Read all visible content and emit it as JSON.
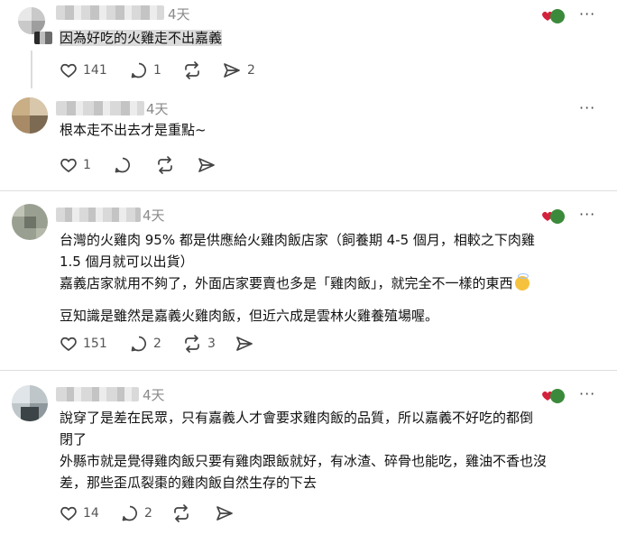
{
  "posts": [
    {
      "time": "4天",
      "lines": [
        "因為好吃的火雞走不出嘉義"
      ],
      "likes": "141",
      "replies": "1",
      "reposts": "",
      "shares": "2"
    },
    {
      "time": "4天",
      "lines": [
        "根本走不出去才是重點~"
      ],
      "likes": "1",
      "replies": "",
      "reposts": "",
      "shares": ""
    },
    {
      "time": "4天",
      "lines": [
        "台灣的火雞肉 95% 都是供應給火雞肉飯店家（飼養期 4-5 個月，相較之下肉雞",
        "1.5 個月就可以出貨）",
        "嘉義店家就用不夠了，外面店家要賣也多是「雞肉飯」，就完全不一樣的東西",
        "豆知識是雖然是嘉義火雞肉飯，但近六成是雲林火雞養殖場喔。"
      ],
      "likes": "151",
      "replies": "2",
      "reposts": "3",
      "shares": ""
    },
    {
      "time": "4天",
      "lines": [
        "說穿了是差在民眾，只有嘉義人才會要求雞肉飯的品質，所以嘉義不好吃的都倒",
        "閉了",
        "外縣市就是覺得雞肉飯只要有雞肉跟飯就好，有冰渣、碎骨也能吃，雞油不香也沒",
        "差，那些歪瓜裂棗的雞肉飯自然生存的下去"
      ],
      "likes": "14",
      "replies": "2",
      "reposts": "",
      "shares": ""
    }
  ],
  "icons": {
    "like": "heart-icon",
    "reply": "comment-icon",
    "repost": "repost-icon",
    "share": "share-icon",
    "more": "more-icon"
  }
}
